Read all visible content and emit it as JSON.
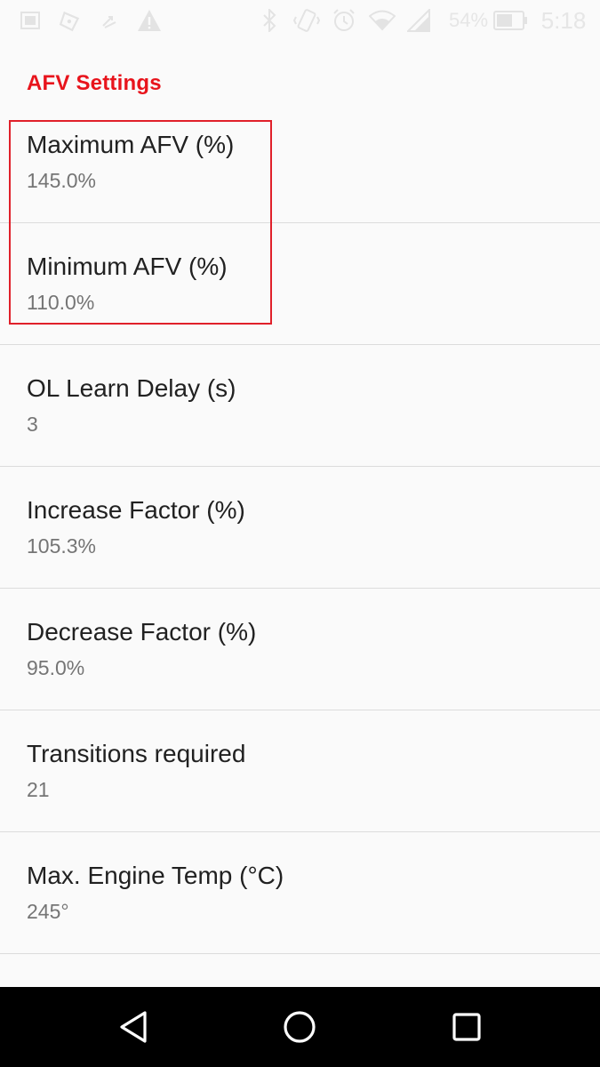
{
  "status_bar": {
    "battery_percent": "54%",
    "time": "5:18"
  },
  "section": {
    "title": "AFV Settings",
    "accent_color": "#e8141c"
  },
  "preferences": [
    {
      "title": "Maximum AFV (%)",
      "summary": "145.0%"
    },
    {
      "title": "Minimum AFV (%)",
      "summary": "110.0%"
    },
    {
      "title": "OL Learn Delay (s)",
      "summary": "3"
    },
    {
      "title": "Increase Factor (%)",
      "summary": "105.3%"
    },
    {
      "title": "Decrease Factor (%)",
      "summary": "95.0%"
    },
    {
      "title": "Transitions required",
      "summary": "21"
    },
    {
      "title": "Max. Engine Temp (°C)",
      "summary": "245°"
    }
  ],
  "nav_bar": {
    "back_icon": "back-triangle-icon",
    "home_icon": "home-circle-icon",
    "recents_icon": "recents-square-icon"
  }
}
